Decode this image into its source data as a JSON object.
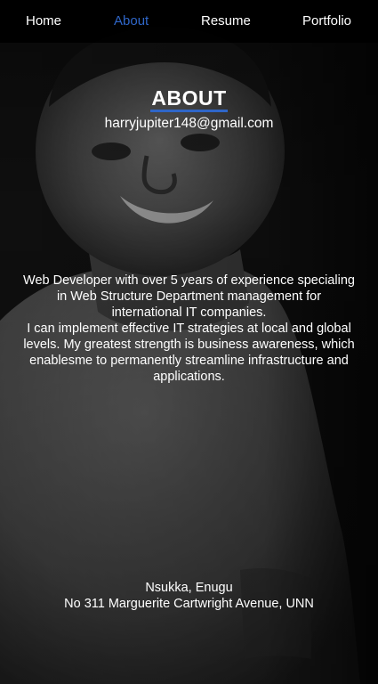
{
  "nav": {
    "items": [
      {
        "label": "Home",
        "active": false
      },
      {
        "label": "About",
        "active": true
      },
      {
        "label": "Resume",
        "active": false
      },
      {
        "label": "Portfolio",
        "active": false
      }
    ],
    "active_color": "#2f66c8"
  },
  "about": {
    "title": "ABOUT",
    "email": "harryjupiter148@gmail.com",
    "bio_line1": "Web Developer with over 5 years of experience specialing in Web Structure Department management for international IT companies.",
    "bio_line2": "I can implement effective IT strategies at local and global levels. My greatest strength is business awareness, which enablesme to permanently streamline infrastructure and applications.",
    "location": "Nsukka, Enugu",
    "street": "No 311 Marguerite Cartwright Avenue, UNN"
  },
  "background": {
    "image": "grayscale-portrait-photo"
  }
}
